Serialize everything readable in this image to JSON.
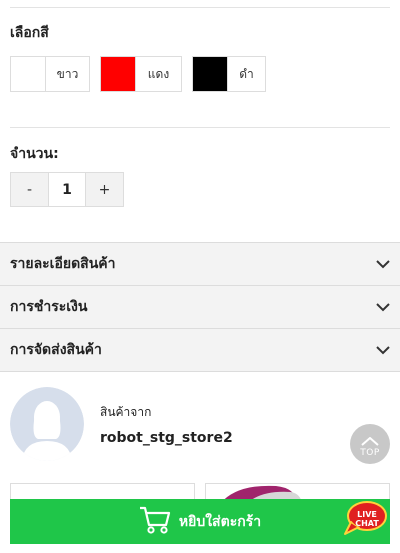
{
  "color_section": {
    "label": "เลือกสี",
    "options": [
      {
        "name": "ขาว",
        "swatch": "#ffffff"
      },
      {
        "name": "แดง",
        "swatch": "#ff0000"
      },
      {
        "name": "ดำ",
        "swatch": "#000000"
      }
    ]
  },
  "quantity_section": {
    "label": "จำนวน:",
    "minus": "-",
    "value": "1",
    "plus": "+"
  },
  "accordion": [
    {
      "title": "รายละเอียดสินค้า",
      "icon": "chevron-down-icon"
    },
    {
      "title": "การชำระเงิน",
      "icon": "chevron-down-icon"
    },
    {
      "title": "การจัดส่งสินค้า",
      "icon": "chevron-down-icon"
    }
  ],
  "seller": {
    "from_label": "สินค้าจาก",
    "store_name": "robot_stg_store2"
  },
  "scroll_top": {
    "label": "TOP"
  },
  "cart": {
    "label": "หยิบใส่ตะกร้า",
    "color": "#1fc649"
  },
  "livechat": {
    "line1": "LIVE",
    "line2": "CHAT",
    "color": "#e02020"
  }
}
